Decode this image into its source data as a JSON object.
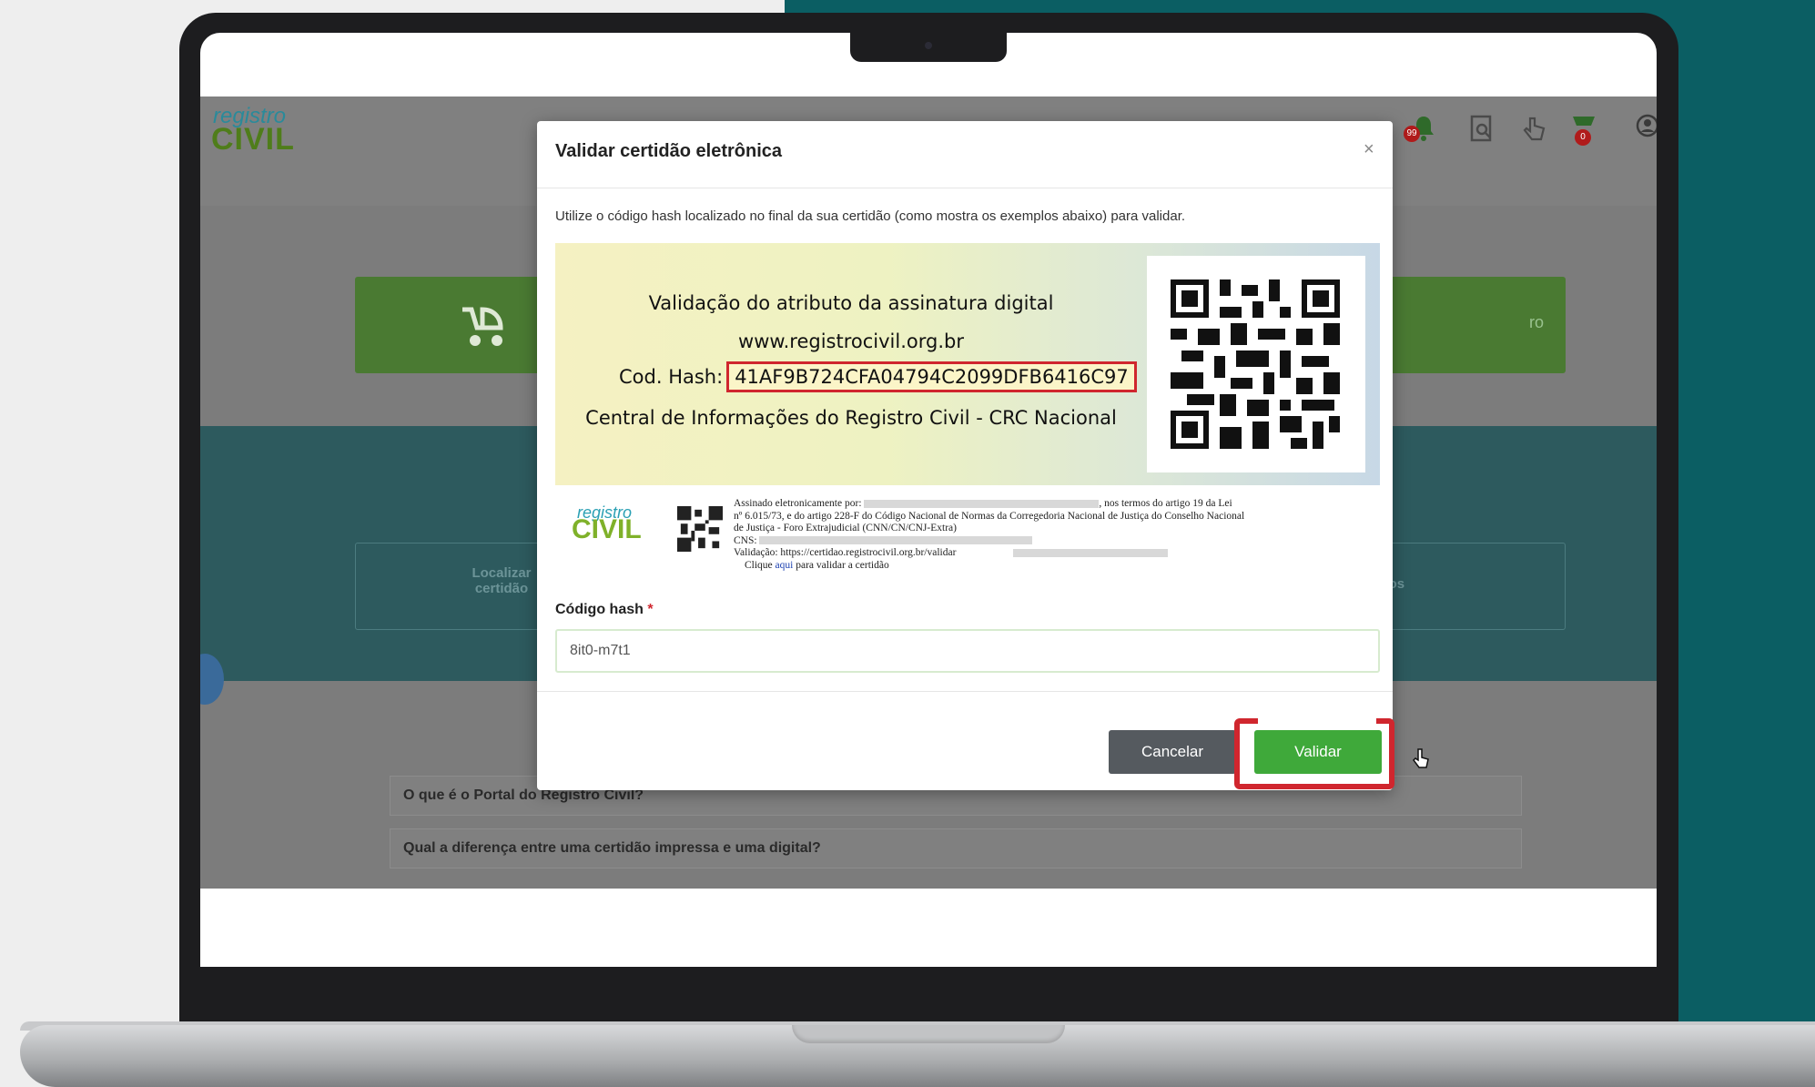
{
  "background_page": {
    "logo_top": "registro",
    "logo_bottom": "CIVIL",
    "header_badges": {
      "notifications": "99",
      "cart": "0"
    },
    "banner_right_text": "ro",
    "service_cards": [
      {
        "label": "Localizar\ncertidão"
      },
      {
        "label": "os os serviços"
      }
    ],
    "faq_items": [
      "O que é o Portal do Registro Civil?",
      "Qual a diferença entre uma certidão impressa e uma digital?"
    ]
  },
  "modal": {
    "title": "Validar certidão eletrônica",
    "close_symbol": "×",
    "instructions": "Utilize o código hash localizado no final da sua certidão (como mostra os exemplos abaixo) para validar.",
    "signature_example": {
      "line1": "Validação do atributo da assinatura digital",
      "line2": "www.registrocivil.org.br",
      "hash_label": "Cod. Hash:",
      "hash_value": "41AF9B724CFA04794C2099DFB6416C97",
      "line4": "Central de Informações do Registro Civil - CRC Nacional"
    },
    "certificate_example": {
      "logo_top": "registro",
      "logo_bottom": "CIVIL",
      "signed_by": "Assinado eletronicamente por:",
      "terms": ", nos termos do artigo 19 da Lei",
      "line2": "nº 6.015/73, e do artigo 228-F do Código Nacional de Normas da Corregedoria Nacional de Justiça do Conselho Nacional",
      "line3": "de Justiça - Foro Extrajudicial (CNN/CN/CNJ-Extra)",
      "cns": "CNS:",
      "validation": "Validação: https://certidao.registrocivil.org.br/validar",
      "click_prefix": "Clique",
      "click_link": "aqui",
      "click_suffix": "para validar a certidão"
    },
    "hash_field": {
      "label": "Código hash",
      "required_marker": "*",
      "value": "8it0-m7t1"
    },
    "buttons": {
      "cancel": "Cancelar",
      "validate": "Validar"
    }
  },
  "colors": {
    "validate_button": "#3fa93a",
    "cancel_button": "#555a5f",
    "highlight": "#d0262e",
    "teal_background": "#0b5e63"
  }
}
